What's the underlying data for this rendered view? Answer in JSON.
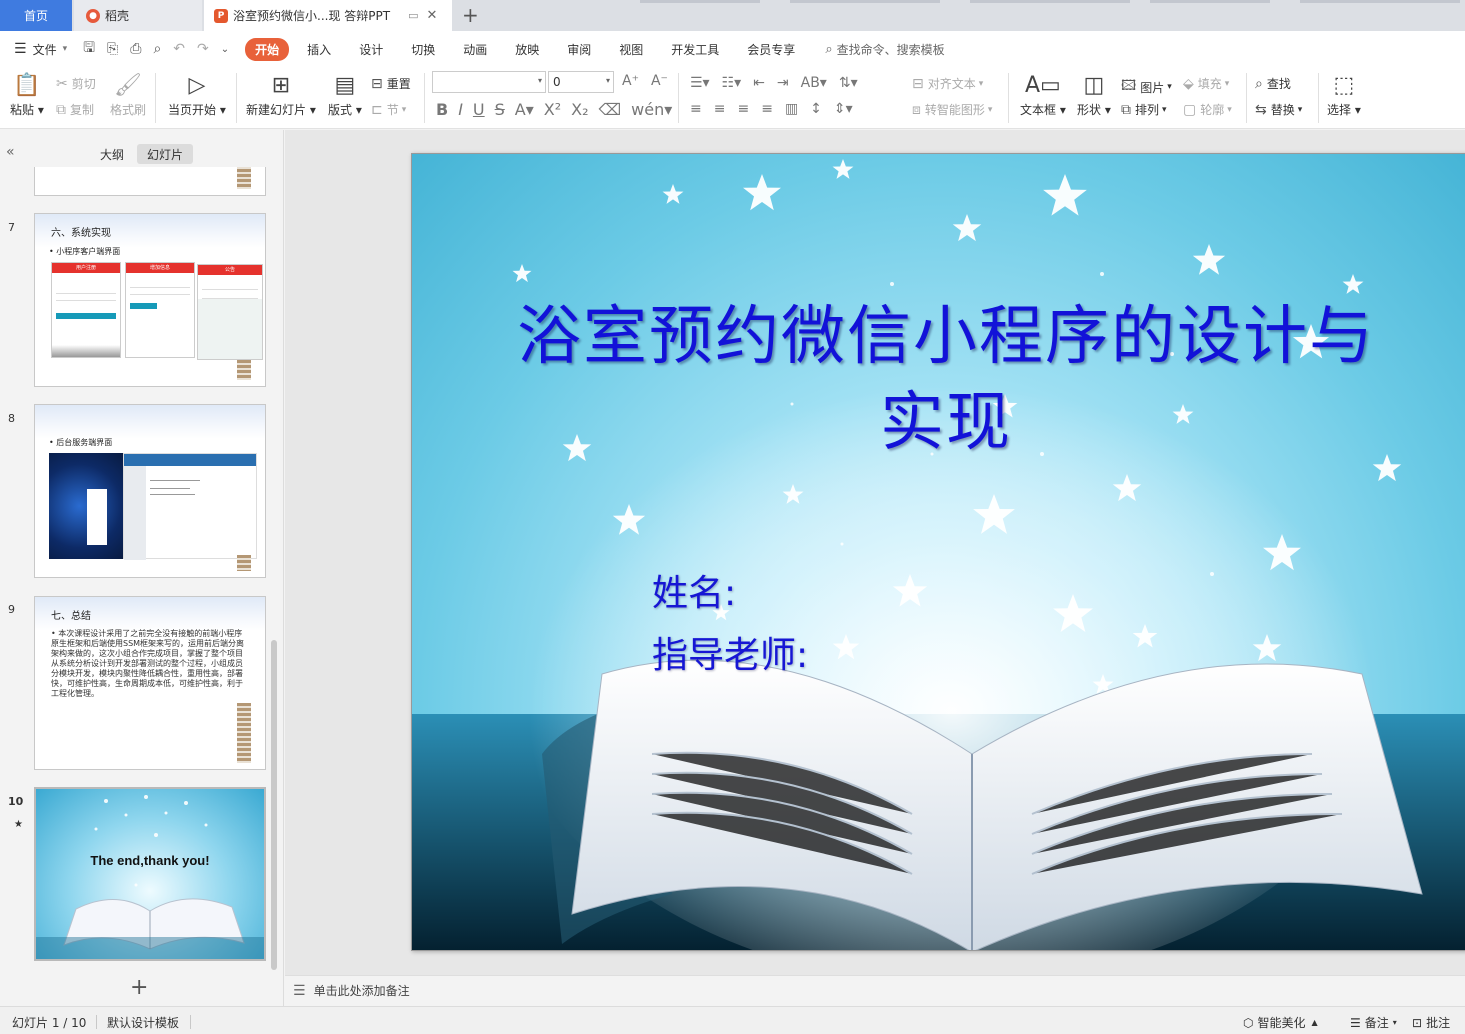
{
  "tabs": {
    "home": "首页",
    "docer": "稻壳",
    "document": "浴室预约微信小...现 答辩PPT"
  },
  "menu": {
    "file": "文件",
    "tabs": [
      "开始",
      "插入",
      "设计",
      "切换",
      "动画",
      "放映",
      "审阅",
      "视图",
      "开发工具",
      "会员专享"
    ],
    "search": "查找命令、搜索模板"
  },
  "ribbon": {
    "paste": "粘贴",
    "cut": "剪切",
    "copy": "复制",
    "format_painter": "格式刷",
    "from_current": "当页开始",
    "new_slide": "新建幻灯片",
    "layout": "版式",
    "reset": "重置",
    "section": "节",
    "font_size": "0",
    "align_text": "对齐文本",
    "smartart": "转智能图形",
    "textbox": "文本框",
    "shape": "形状",
    "picture": "图片",
    "arrange": "排列",
    "fill": "填充",
    "outline": "轮廓",
    "find": "查找",
    "replace": "替换",
    "select": "选择"
  },
  "panel": {
    "outline_tab": "大纲",
    "slides_tab": "幻灯片"
  },
  "thumbnails": [
    {
      "num": "7",
      "title": "六、系统实现",
      "bullet": "• 小程序客户端界面",
      "screen_titles": [
        "用户注册",
        "增加信息",
        "公告"
      ]
    },
    {
      "num": "8",
      "bullet": "• 后台服务端界面"
    },
    {
      "num": "9",
      "title": "七、总结",
      "paragraph": "• 本次课程设计采用了之前完全没有接触的前端小程序原生框架和后端使用SSM框架来写的，运用前后端分离架构来做的，这次小组合作完成项目，掌握了整个项目从系统分析设计到开发部署测试的整个过程，小组成员分模块开发，模块内聚性降低耦合性，重用性高，部署快，可维护性高，生命周期成本低，可维护性高，利于工程化管理。"
    },
    {
      "num": "10",
      "caption": "The end,thank you!"
    }
  ],
  "slide": {
    "title": "浴室预约微信小程序的设计与实现",
    "name_label": "姓名:",
    "teacher_label": "指导老师:"
  },
  "notes": {
    "placeholder": "单击此处添加备注"
  },
  "statusbar": {
    "slide_counter": "幻灯片 1 / 10",
    "template": "默认设计模板",
    "beautify": "智能美化",
    "notes": "备注",
    "comments": "批注"
  },
  "colors": {
    "accent": "#e8613a",
    "home_tab": "#3f7be0",
    "title_blue": "#1212d8"
  }
}
